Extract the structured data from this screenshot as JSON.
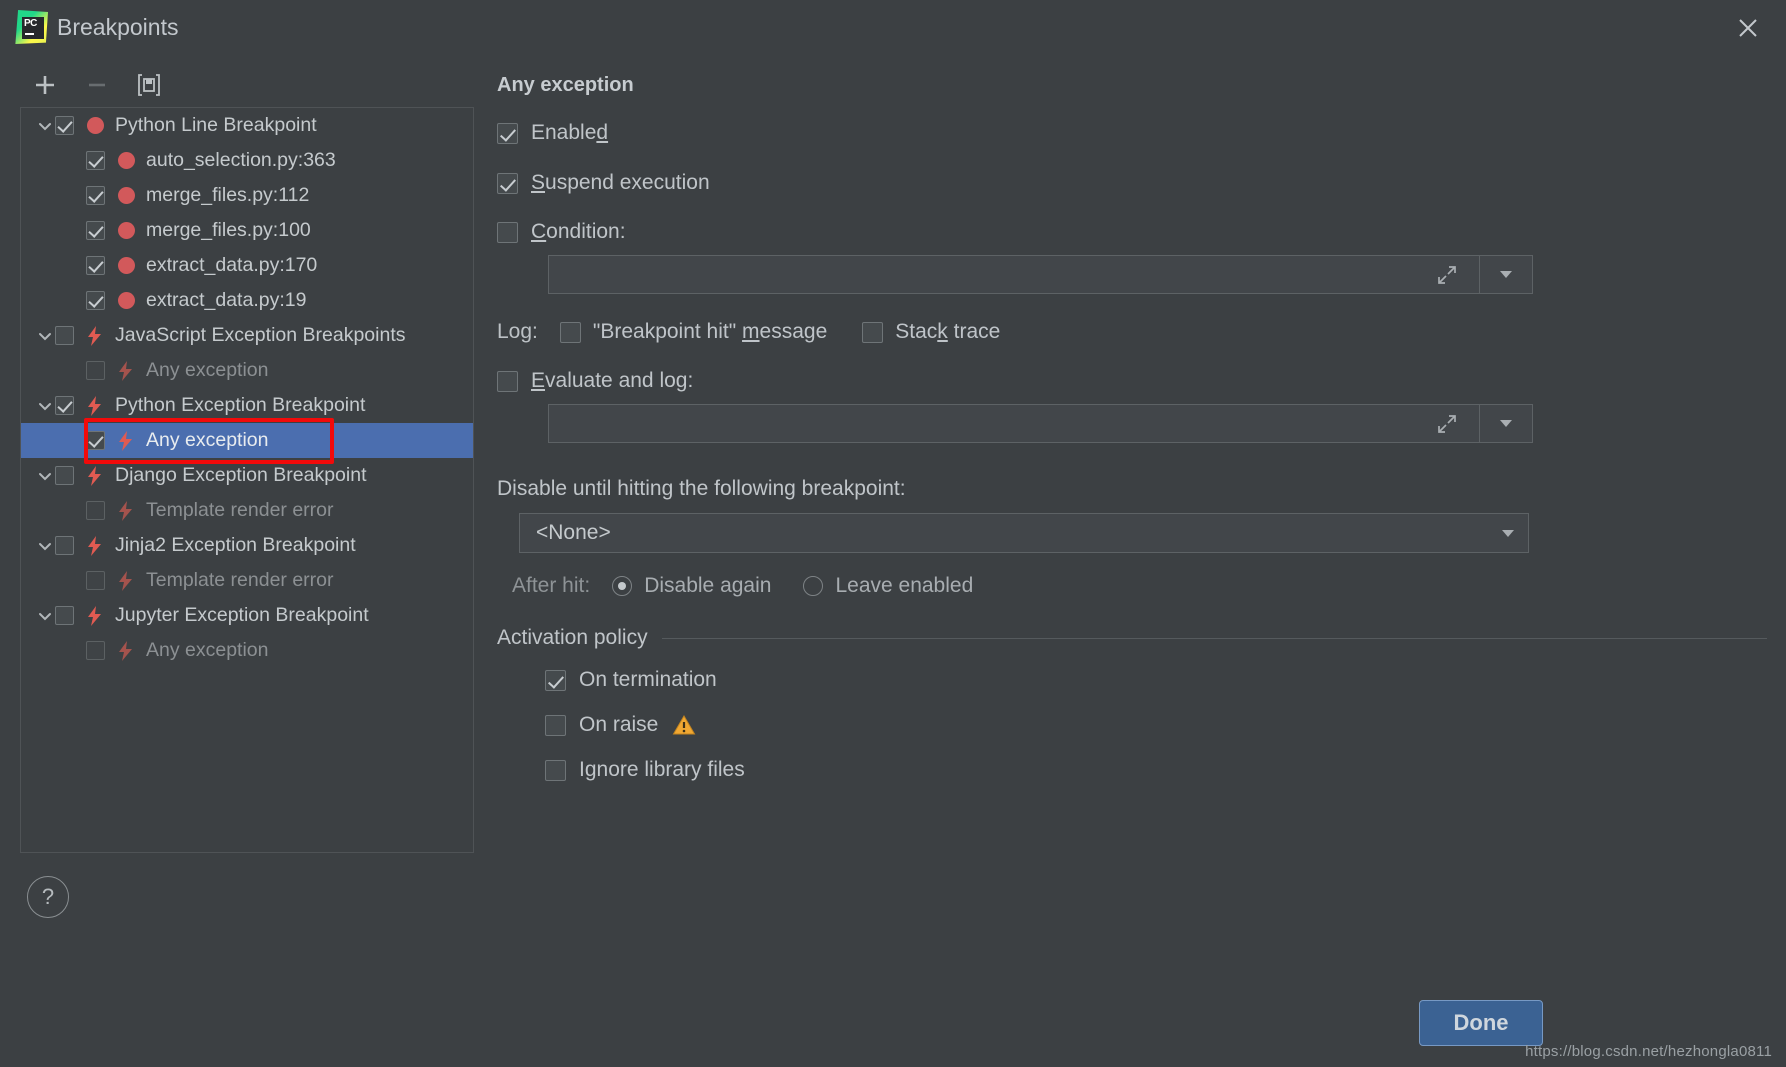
{
  "window": {
    "title": "Breakpoints",
    "logo_text": "PC",
    "close_icon": "close-icon"
  },
  "toolbar": {
    "add_label": "+",
    "remove_label": "−",
    "mute_label": "[■]"
  },
  "tree": {
    "items": [
      {
        "level": 1,
        "arrow": "expanded",
        "checked": true,
        "icon": "line-breakpoint-dot",
        "label": "Python Line Breakpoint",
        "muted": false,
        "selected": false
      },
      {
        "level": 2,
        "arrow": "none",
        "checked": true,
        "icon": "line-breakpoint-dot",
        "label": "auto_selection.py:363",
        "muted": false,
        "selected": false
      },
      {
        "level": 2,
        "arrow": "none",
        "checked": true,
        "icon": "line-breakpoint-dot",
        "label": "merge_files.py:112",
        "muted": false,
        "selected": false
      },
      {
        "level": 2,
        "arrow": "none",
        "checked": true,
        "icon": "line-breakpoint-dot",
        "label": "merge_files.py:100",
        "muted": false,
        "selected": false
      },
      {
        "level": 2,
        "arrow": "none",
        "checked": true,
        "icon": "line-breakpoint-dot",
        "label": "extract_data.py:170",
        "muted": false,
        "selected": false
      },
      {
        "level": 2,
        "arrow": "none",
        "checked": true,
        "icon": "line-breakpoint-dot",
        "label": "extract_data.py:19",
        "muted": false,
        "selected": false
      },
      {
        "level": 1,
        "arrow": "expanded",
        "checked": false,
        "icon": "exception-bolt",
        "label": "JavaScript Exception Breakpoints",
        "muted": false,
        "selected": false
      },
      {
        "level": 2,
        "arrow": "none",
        "checked": false,
        "icon": "exception-bolt-dim",
        "label": "Any exception",
        "muted": true,
        "selected": false
      },
      {
        "level": 1,
        "arrow": "expanded",
        "checked": true,
        "icon": "exception-bolt",
        "label": "Python Exception Breakpoint",
        "muted": false,
        "selected": false
      },
      {
        "level": 2,
        "arrow": "none",
        "checked": true,
        "icon": "exception-bolt",
        "label": "Any exception",
        "muted": false,
        "selected": true
      },
      {
        "level": 1,
        "arrow": "expanded",
        "checked": false,
        "icon": "exception-bolt",
        "label": "Django Exception Breakpoint",
        "muted": false,
        "selected": false
      },
      {
        "level": 2,
        "arrow": "none",
        "checked": false,
        "icon": "exception-bolt-dim",
        "label": "Template render error",
        "muted": true,
        "selected": false
      },
      {
        "level": 1,
        "arrow": "expanded",
        "checked": false,
        "icon": "exception-bolt",
        "label": "Jinja2 Exception Breakpoint",
        "muted": false,
        "selected": false
      },
      {
        "level": 2,
        "arrow": "none",
        "checked": false,
        "icon": "exception-bolt-dim",
        "label": "Template render error",
        "muted": true,
        "selected": false
      },
      {
        "level": 1,
        "arrow": "expanded",
        "checked": false,
        "icon": "exception-bolt",
        "label": "Jupyter Exception Breakpoint",
        "muted": false,
        "selected": false
      },
      {
        "level": 2,
        "arrow": "none",
        "checked": false,
        "icon": "exception-bolt-dim",
        "label": "Any exception",
        "muted": true,
        "selected": false
      }
    ]
  },
  "detail": {
    "title": "Any exception",
    "enabled": {
      "label_pre": "Enable",
      "label_mn": "d",
      "label_post": "",
      "checked": true
    },
    "suspend": {
      "label_pre": "",
      "label_mn": "S",
      "label_post": "uspend execution",
      "checked": true
    },
    "condition": {
      "label_pre": "",
      "label_mn": "C",
      "label_post": "ondition:",
      "checked": false,
      "value": "",
      "expand_icon": "expand-editor-icon",
      "dropdown_icon": "chevron-down-icon"
    },
    "log": {
      "label": "Log:",
      "breakpoint_hit": {
        "label_pre": "\"Breakpoint hit\" ",
        "label_mn": "m",
        "label_post": "essage",
        "checked": false
      },
      "stack_trace": {
        "label_pre": "Stac",
        "label_mn": "k",
        "label_post": " trace",
        "checked": false
      }
    },
    "evaluate": {
      "label_pre": "",
      "label_mn": "E",
      "label_post": "valuate and log:",
      "checked": false,
      "value": "",
      "expand_icon": "expand-editor-icon",
      "dropdown_icon": "chevron-down-icon"
    },
    "disable_until": {
      "title": "Disable until hitting the following breakpoint:",
      "selected": "<None>",
      "dropdown_icon": "chevron-down-icon"
    },
    "after_hit": {
      "label": "After hit:",
      "options": [
        {
          "label": "Disable again",
          "selected": true
        },
        {
          "label": "Leave enabled",
          "selected": false
        }
      ]
    },
    "activation_policy": {
      "title": "Activation policy",
      "items": [
        {
          "label": "On termination",
          "checked": true,
          "warning": false
        },
        {
          "label": "On raise",
          "checked": false,
          "warning": true,
          "warning_icon": "warning-triangle-icon"
        },
        {
          "label": "Ignore library files",
          "checked": false,
          "warning": false
        }
      ]
    }
  },
  "footer": {
    "help_label": "?",
    "done_label": "Done",
    "watermark": "https://blog.csdn.net/hezhongla0811"
  },
  "colors": {
    "background": "#3c4043",
    "selection": "#4b6eaf",
    "breakpoint_red": "#d2595b",
    "annotation_red": "#f20a0a",
    "accent_button": "#3b6293",
    "warning_amber": "#f0a732"
  }
}
